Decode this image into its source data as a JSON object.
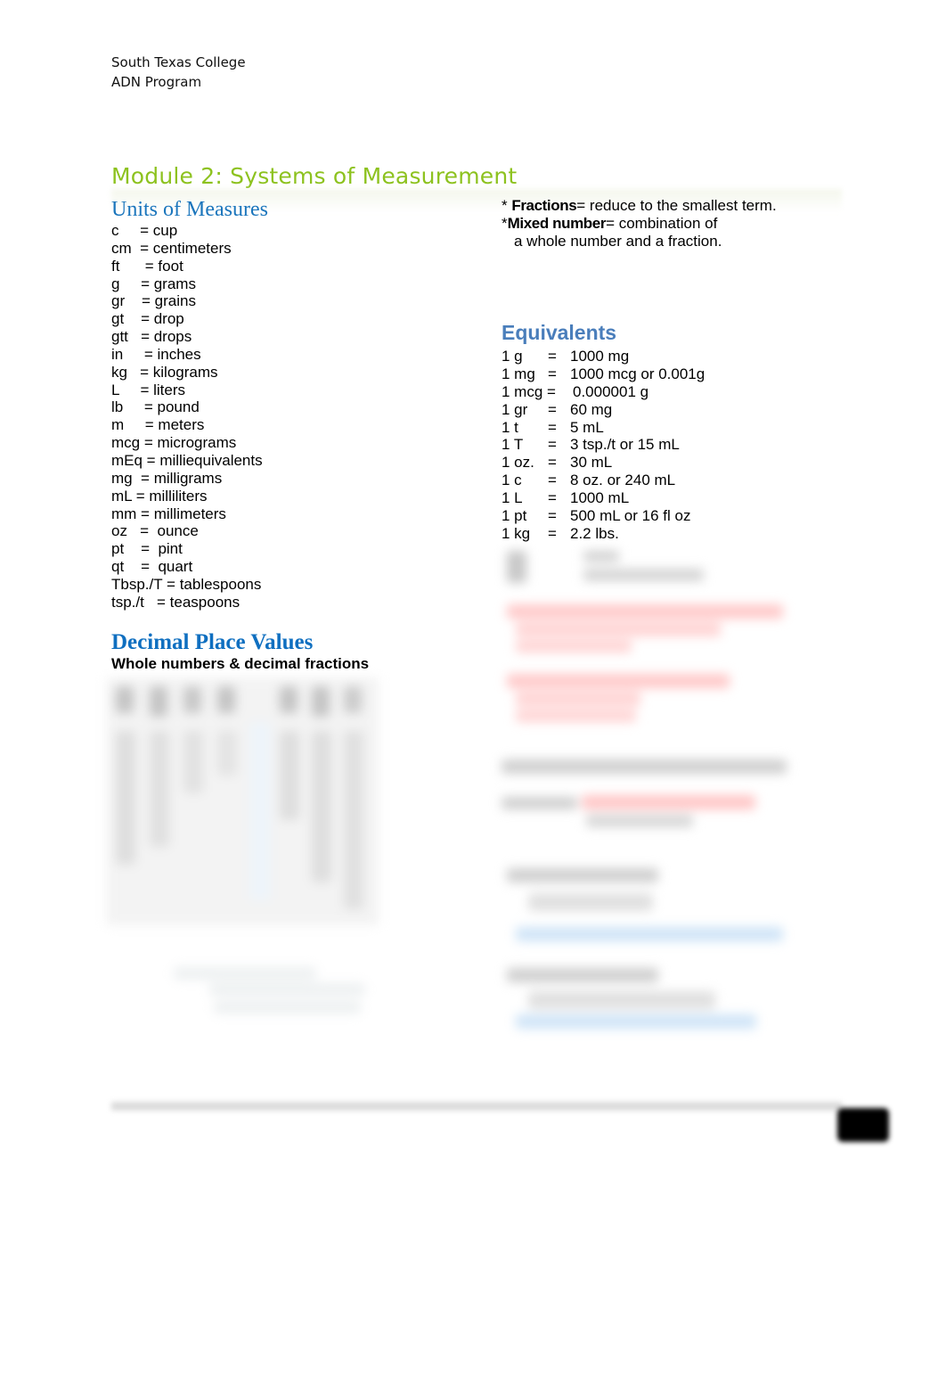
{
  "header": {
    "institution": "South Texas College",
    "program": "ADN Program"
  },
  "document": {
    "title": "Module 2: Systems of Measurement",
    "accent_color": "#8dc21f"
  },
  "units_of_measures": {
    "heading": "Units of Measures",
    "heading_color": "#1a75bc",
    "items": [
      "c     = cup",
      "cm  = centimeters",
      "ft      = foot",
      "g     = grams",
      "gr    = grains",
      "gt    = drop",
      "gtt   = drops",
      "in     = inches",
      "kg   = kilograms",
      "L     = liters",
      "lb     = pound",
      "m     = meters",
      "mcg = micrograms",
      "mEq = milliequivalents",
      "mg  = milligrams",
      "mL = milliliters",
      "mm = millimeters",
      "oz   =  ounce",
      "pt    =  pint",
      "qt    =  quart",
      "Tbsp./T = tablespoons",
      "tsp./t   = teaspoons"
    ]
  },
  "notes": {
    "fractions_term": "Fractions",
    "fractions_def": "= reduce to the smallest term.",
    "mixed_term": "Mixed number",
    "mixed_def": "= combination of",
    "mixed_def_cont": "a whole number and a fraction.",
    "bullet": "*"
  },
  "equivalents": {
    "heading": "Equivalents",
    "heading_color": "#4a7ebb",
    "rows": [
      {
        "unit": "1 g",
        "eq": "=",
        "value": "1000 mg"
      },
      {
        "unit": "1 mg",
        "eq": "=",
        "value": "1000 mcg or 0.001g"
      },
      {
        "unit": "1 mcg =",
        "eq": "",
        "value": "0.000001 g"
      },
      {
        "unit": "1 gr",
        "eq": "=",
        "value": "60 mg"
      },
      {
        "unit": "1 t",
        "eq": "=",
        "value": "5 mL"
      },
      {
        "unit": "1 T",
        "eq": "=",
        "value": "3 tsp./t or 15 mL"
      },
      {
        "unit": "1 oz.",
        "eq": "=",
        "value": "30 mL"
      },
      {
        "unit": "1 c",
        "eq": "=",
        "value": "8 oz. or 240 mL"
      },
      {
        "unit": "1 L",
        "eq": "=",
        "value": "1000 mL"
      },
      {
        "unit": "1 pt",
        "eq": "=",
        "value": "500 mL or 16 fl oz"
      },
      {
        "unit": "1 kg",
        "eq": "=",
        "value": "2.2 lbs."
      }
    ]
  },
  "decimal_place_values": {
    "heading": "Decimal Place Values",
    "subheading": "Whole numbers & decimal fractions",
    "heading_color": "#0f6fc0"
  }
}
